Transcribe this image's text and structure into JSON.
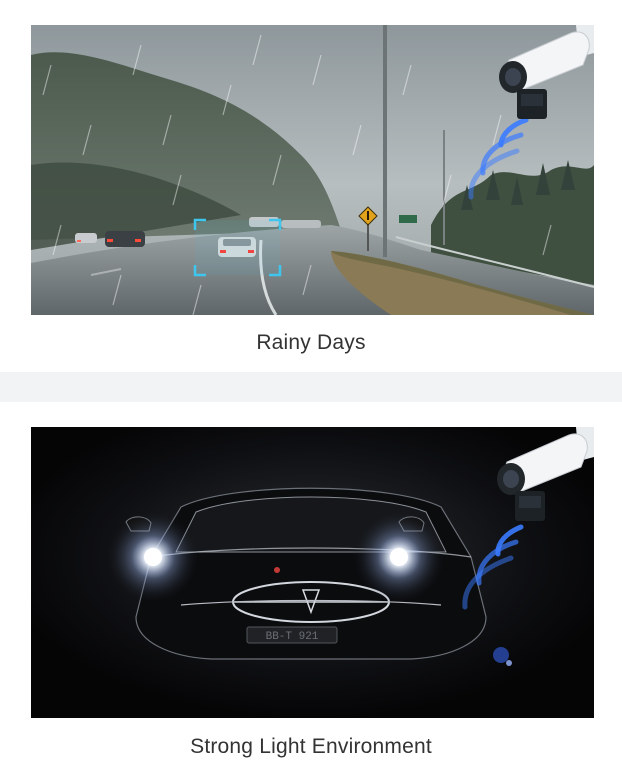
{
  "cards": [
    {
      "caption": "Rainy Days",
      "scene": "rainy-highway",
      "icons": [
        "security-camera-icon",
        "detection-waves-icon",
        "vehicle-detection-box-icon",
        "road-sign-icon"
      ]
    },
    {
      "caption": "Strong Light Environment",
      "scene": "car-headlights-dark",
      "plate_text": "BB-T 921",
      "icons": [
        "security-camera-icon",
        "detection-waves-icon"
      ]
    }
  ],
  "colors": {
    "page_background": "#f2f3f5",
    "card_background": "#ffffff",
    "caption_text": "#333333",
    "detection_accent": "#3fc6ee",
    "wave_blue": "#3a7bff"
  }
}
